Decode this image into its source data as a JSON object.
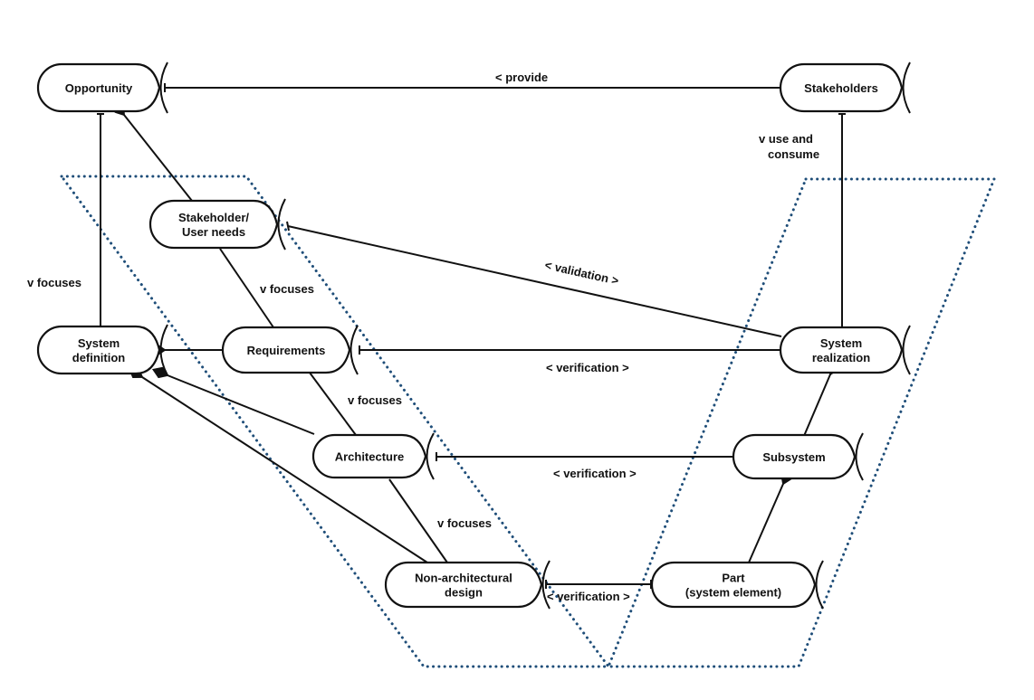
{
  "diagram": {
    "nodes": [
      {
        "id": "opportunity",
        "lines": [
          "Opportunity"
        ]
      },
      {
        "id": "stakeholders",
        "lines": [
          "Stakeholders"
        ]
      },
      {
        "id": "stakeholder-user-needs",
        "lines": [
          "Stakeholder/",
          "User needs"
        ]
      },
      {
        "id": "system-definition",
        "lines": [
          "System",
          "definition"
        ]
      },
      {
        "id": "requirements",
        "lines": [
          "Requirements"
        ]
      },
      {
        "id": "system-realization",
        "lines": [
          "System",
          "realization"
        ]
      },
      {
        "id": "architecture",
        "lines": [
          "Architecture"
        ]
      },
      {
        "id": "subsystem",
        "lines": [
          "Subsystem"
        ]
      },
      {
        "id": "non-architectural-design",
        "lines": [
          "Non-architectural",
          "design"
        ]
      },
      {
        "id": "part",
        "lines": [
          "Part",
          "(system element)"
        ]
      }
    ],
    "edges": [
      {
        "from": "stakeholders",
        "to": "opportunity",
        "label": "< provide",
        "end": "tee"
      },
      {
        "from": "stakeholders",
        "to": "system-realization",
        "label": "v use and consume",
        "end": "tee"
      },
      {
        "from": "opportunity",
        "to": "system-definition",
        "label": "v focuses",
        "end": "tee"
      },
      {
        "from": "stakeholder-user-needs",
        "to": "opportunity",
        "label": "",
        "end": "diamond"
      },
      {
        "from": "stakeholder-user-needs",
        "to": "requirements",
        "label": "v focuses",
        "end": "none"
      },
      {
        "from": "system-realization",
        "to": "stakeholder-user-needs",
        "label": "< validation >",
        "end": "tee"
      },
      {
        "from": "requirements",
        "to": "system-definition",
        "label": "",
        "end": "diamond"
      },
      {
        "from": "system-realization",
        "to": "requirements",
        "label": "< verification >",
        "end": "tee"
      },
      {
        "from": "requirements",
        "to": "architecture",
        "label": "v focuses",
        "end": "none"
      },
      {
        "from": "architecture",
        "to": "system-definition",
        "label": "",
        "end": "diamond"
      },
      {
        "from": "subsystem",
        "to": "architecture",
        "label": "< verification >",
        "end": "tee"
      },
      {
        "from": "subsystem",
        "to": "system-realization",
        "label": "",
        "end": "diamond"
      },
      {
        "from": "architecture",
        "to": "non-architectural-design",
        "label": "v focuses",
        "end": "none"
      },
      {
        "from": "non-architectural-design",
        "to": "system-definition",
        "label": "",
        "end": "diamond"
      },
      {
        "from": "part",
        "to": "non-architectural-design",
        "label": "< verification >",
        "end": "tee"
      },
      {
        "from": "part",
        "to": "subsystem",
        "label": "",
        "end": "diamond"
      }
    ],
    "labels": {
      "provide": "< provide",
      "use_and_consume": [
        "v use and",
        "consume"
      ],
      "focuses_left": "v focuses",
      "focuses_needs": "v focuses",
      "focuses_req": "v focuses",
      "focuses_arch": "v focuses",
      "validation": "< validation >",
      "verification_req": "< verification >",
      "verification_arch": "< verification >",
      "verification_part": "< verification >"
    },
    "regions": [
      {
        "id": "definition-region",
        "style": "dotted",
        "color": "#1f4e79"
      },
      {
        "id": "realization-region",
        "style": "dotted",
        "color": "#1f4e79"
      }
    ]
  }
}
